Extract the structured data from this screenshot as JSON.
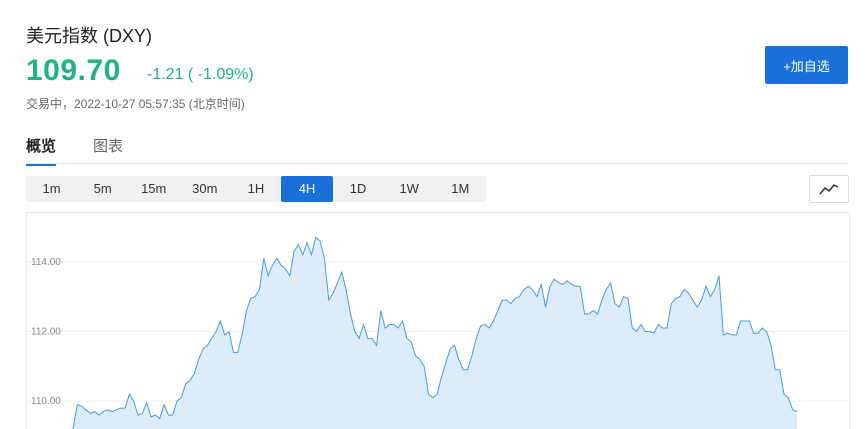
{
  "header": {
    "title": "美元指数 (DXY)",
    "price": "109.70",
    "change": "-1.21 ( -1.09%)",
    "status": "交易中，2022-10-27 05:57:35 (北京时间)",
    "add_button": "+加自选"
  },
  "tabs": [
    {
      "label": "概览",
      "active": true
    },
    {
      "label": "图表",
      "active": false
    }
  ],
  "intervals": [
    {
      "label": "1m",
      "active": false
    },
    {
      "label": "5m",
      "active": false
    },
    {
      "label": "15m",
      "active": false
    },
    {
      "label": "30m",
      "active": false
    },
    {
      "label": "1H",
      "active": false
    },
    {
      "label": "4H",
      "active": true
    },
    {
      "label": "1D",
      "active": false
    },
    {
      "label": "1W",
      "active": false
    },
    {
      "label": "1M",
      "active": false
    }
  ],
  "icons": {
    "chart_toggle": "line-chart-icon"
  },
  "colors": {
    "accent": "#1a6fd8",
    "up_down": "#21b383",
    "line": "#4a9be0",
    "fill": "#dcecfb"
  },
  "chart_data": {
    "type": "area",
    "yticks": [
      "114.00",
      "112.00",
      "110.00"
    ],
    "ylim": [
      109.2,
      115.4
    ],
    "values": [
      109.2,
      109.9,
      109.85,
      109.75,
      109.65,
      109.7,
      109.6,
      109.7,
      109.75,
      109.7,
      109.75,
      109.8,
      109.8,
      110.2,
      110.0,
      109.6,
      109.65,
      109.95,
      109.55,
      109.6,
      109.5,
      109.9,
      109.6,
      109.6,
      110.0,
      110.1,
      110.5,
      110.6,
      110.8,
      111.2,
      111.5,
      111.6,
      111.8,
      112.0,
      112.3,
      111.9,
      112.0,
      111.4,
      111.4,
      111.9,
      112.6,
      112.95,
      113.0,
      113.2,
      114.1,
      113.6,
      113.9,
      114.1,
      113.9,
      113.8,
      113.6,
      114.3,
      114.5,
      114.2,
      114.55,
      114.2,
      114.7,
      114.6,
      114.1,
      112.9,
      113.1,
      113.4,
      113.7,
      113.2,
      112.5,
      112.0,
      111.8,
      112.2,
      111.8,
      111.8,
      111.6,
      112.6,
      112.1,
      112.2,
      112.2,
      112.1,
      112.3,
      111.8,
      111.7,
      111.3,
      111.2,
      111.0,
      110.2,
      110.1,
      110.2,
      110.7,
      111.1,
      111.5,
      111.6,
      111.2,
      110.9,
      110.9,
      111.3,
      111.8,
      112.15,
      112.2,
      112.1,
      112.3,
      112.6,
      112.9,
      112.9,
      112.8,
      112.95,
      113.0,
      113.2,
      113.3,
      113.2,
      113.0,
      113.35,
      112.7,
      113.3,
      113.5,
      113.4,
      113.35,
      113.45,
      113.35,
      113.3,
      113.3,
      112.5,
      112.5,
      112.6,
      112.5,
      112.9,
      113.2,
      113.4,
      112.8,
      112.7,
      113.0,
      112.95,
      112.1,
      112.0,
      112.2,
      112.0,
      112.0,
      111.95,
      112.2,
      112.1,
      112.1,
      112.8,
      112.95,
      113.0,
      113.2,
      113.1,
      112.9,
      112.7,
      112.9,
      113.3,
      113.0,
      113.2,
      113.6,
      111.9,
      111.95,
      111.9,
      111.9,
      112.3,
      112.3,
      112.3,
      111.95,
      111.95,
      112.1,
      112.0,
      111.6,
      110.9,
      110.9,
      110.2,
      110.1,
      109.75,
      109.7
    ]
  }
}
